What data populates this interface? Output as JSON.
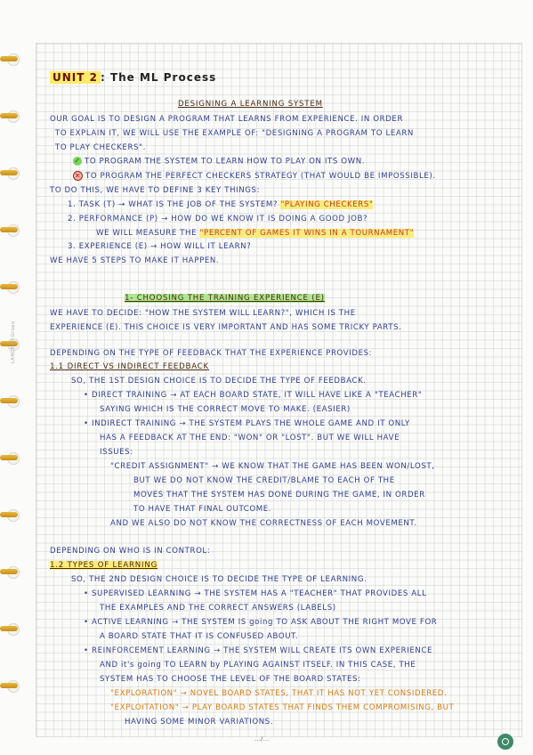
{
  "notebook": {
    "margin_note": "LANCERO Grupo",
    "footer": "…/…"
  },
  "header": {
    "unit_tag": "UNIT 2",
    "unit_title": ": The ML Process"
  },
  "section1": {
    "title": "DESIGNING A LEARNING SYSTEM",
    "lines": [
      "OUR GOAL IS TO DESIGN A PROGRAM THAT LEARNS FROM EXPERIENCE. IN ORDER",
      "TO EXPLAIN IT, WE WILL USE THE EXAMPLE OF: \"DESIGNING A PROGRAM TO LEARN",
      "TO PLAY CHECKERS\".",
      "TO PROGRAM THE SYSTEM TO LEARN HOW TO PLAY ON ITS OWN.",
      "TO PROGRAM THE PERFECT CHECKERS STRATEGY (THAT WOULD BE IMPOSSIBLE).",
      "TO DO THIS, WE HAVE TO DEFINE 3 KEY THINGS:",
      "1. TASK (T) → WHAT IS THE JOB OF THE SYSTEM?",
      "\"PLAYING CHECKERS\"",
      "2. PERFORMANCE (P) → HOW DO WE KNOW IT IS DOING A GOOD JOB?",
      "WE WILL MEASURE THE",
      "\"PERCENT OF GAMES IT WINS IN A TOURNAMENT\"",
      "3. EXPERIENCE (E) → HOW WILL IT LEARN?",
      "WE HAVE 5 STEPS TO MAKE IT HAPPEN."
    ]
  },
  "section2": {
    "title": "1- CHOOSING THE TRAINING EXPERIENCE (E)",
    "lines": [
      "WE HAVE TO DECIDE: \"HOW THE SYSTEM WILL LEARN?\", WHICH IS THE",
      "EXPERIENCE (E). THIS CHOICE IS VERY IMPORTANT AND HAS SOME TRICKY PARTS.",
      "DEPENDING ON THE TYPE OF FEEDBACK THAT THE EXPERIENCE PROVIDES:",
      "1.1 DIRECT VS INDIRECT FEEDBACK",
      "SO, THE 1ST DESIGN CHOICE IS TO DECIDE THE TYPE OF FEEDBACK.",
      "• DIRECT TRAINING → AT EACH BOARD STATE, IT WILL HAVE LIKE A \"TEACHER\"",
      "SAYING WHICH IS THE CORRECT MOVE TO MAKE. (EASIER)",
      "• INDIRECT TRAINING → THE SYSTEM PLAYS THE WHOLE GAME AND IT ONLY",
      "HAS A FEEDBACK AT THE END: \"WON\" OR \"LOST\". BUT WE WILL HAVE",
      "ISSUES:",
      "\"CREDIT ASSIGNMENT\" → WE KNOW THAT THE GAME HAS BEEN WON/LOST,",
      "BUT WE DO NOT KNOW THE CREDIT/BLAME TO EACH OF THE",
      "MOVES THAT THE SYSTEM HAS DONE DURING THE GAME, IN ORDER",
      "TO HAVE THAT FINAL OUTCOME.",
      "AND WE ALSO DO NOT KNOW THE CORRECTNESS OF EACH MOVEMENT."
    ]
  },
  "section3": {
    "intro": "DEPENDING ON WHO IS IN CONTROL:",
    "title": "1.2 TYPES OF LEARNING",
    "lines": [
      "SO, THE 2ND DESIGN CHOICE IS TO DECIDE THE TYPE OF LEARNING.",
      "• SUPERVISED LEARNING → THE SYSTEM HAS A \"TEACHER\" THAT PROVIDES ALL",
      "THE EXAMPLES AND THE CORRECT ANSWERS (LABELS)",
      "• ACTIVE LEARNING → THE SYSTEM IS going TO ASK ABOUT THE RIGHT MOVE FOR",
      "A BOARD STATE THAT IT IS CONFUSED ABOUT.",
      "• REINFORCEMENT LEARNING → THE SYSTEM WILL CREATE ITS OWN EXPERIENCE",
      "AND it's going TO LEARN by PLAYING AGAINST ITSELF. IN THIS CASE, THE",
      "SYSTEM HAS TO CHOOSE THE LEVEL OF THE BOARD STATES:",
      "\"EXPLORATION\" → NOVEL BOARD STATES, THAT IT HAS NOT YET CONSIDERED.",
      "\"EXPLOITATION\" → PLAY BOARD STATES THAT FINDS THEM COMPROMISING, BUT",
      "HAVING SOME MINOR VARIATIONS."
    ]
  },
  "colors": {
    "ink_blue": "#2f3f8f",
    "ink_red": "#c23a2a",
    "ink_orange": "#d97a10",
    "highlight_yellow": "#ffe852",
    "highlight_green": "#96e16e"
  }
}
